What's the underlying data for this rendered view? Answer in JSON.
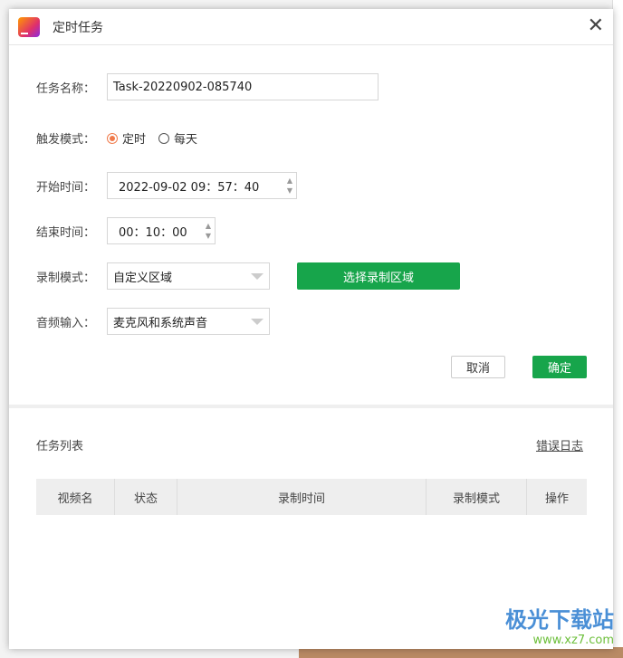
{
  "dialog": {
    "title": "定时任务",
    "close_icon": "close-icon"
  },
  "form": {
    "task_name_label": "任务名称：",
    "task_name_value": "Task-20220902-085740",
    "trigger_label": "触发模式：",
    "trigger_options": [
      "定时",
      "每天"
    ],
    "trigger_selected": "定时",
    "start_label": "开始时间：",
    "start_value": "2022-09-02 09：57：40",
    "end_label": "结束时间：",
    "end_value": "00：10：00",
    "record_mode_label": "录制模式：",
    "record_mode_value": "自定义区域",
    "select_area_button": "选择录制区域",
    "audio_label": "音频输入：",
    "audio_value": "麦克风和系统声音",
    "cancel": "取消",
    "confirm": "确定"
  },
  "tasks": {
    "title": "任务列表",
    "error_log": "错误日志",
    "columns": [
      "视频名",
      "状态",
      "录制时间",
      "录制模式",
      "操作"
    ]
  },
  "watermark": {
    "name": "极光下载站",
    "url": "www.xz7.com"
  },
  "colors": {
    "accent": "#17a54b",
    "radio": "#f07a4a"
  }
}
